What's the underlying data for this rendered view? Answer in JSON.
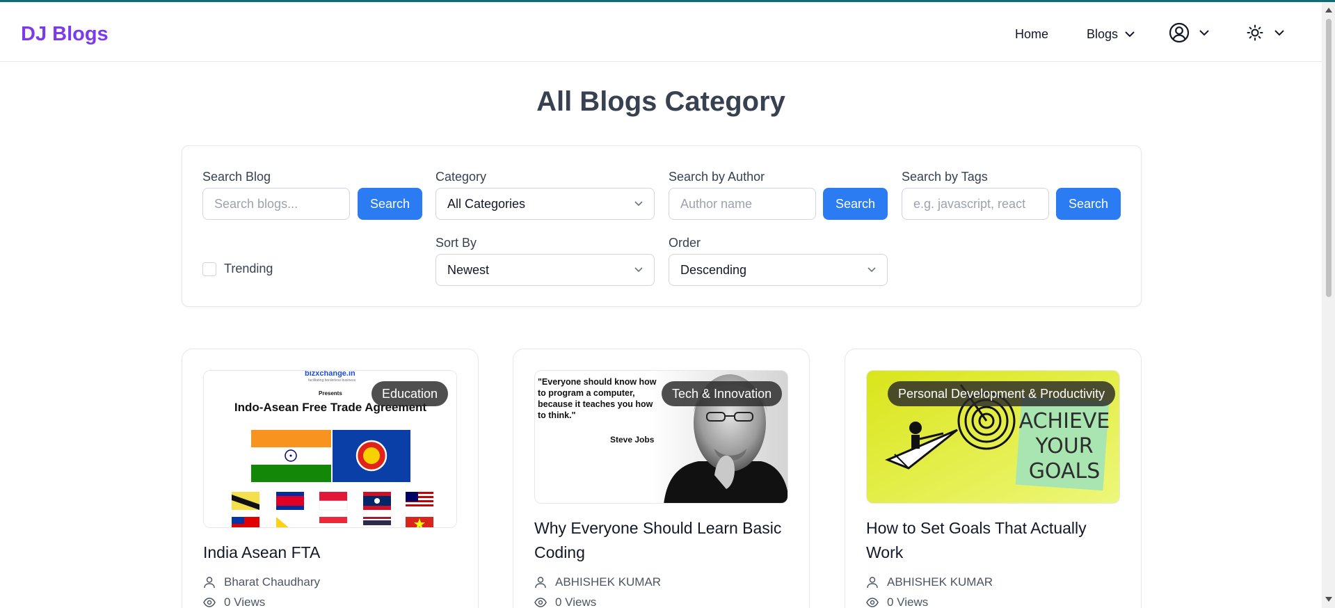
{
  "brand": {
    "logo": "DJ Blogs",
    "logo_color": "#7c3aed",
    "accent": "#2b7cf2"
  },
  "nav": {
    "home": "Home",
    "blogs": "Blogs",
    "user_icon": "user-circle-icon",
    "theme_icon": "sun-icon"
  },
  "page": {
    "title": "All Blogs Category"
  },
  "filters": {
    "search_blog": {
      "label": "Search Blog",
      "placeholder": "Search blogs...",
      "button": "Search"
    },
    "category": {
      "label": "Category",
      "value": "All Categories"
    },
    "author": {
      "label": "Search by Author",
      "placeholder": "Author name",
      "button": "Search"
    },
    "tags": {
      "label": "Search by Tags",
      "placeholder": "e.g. javascript, react",
      "button": "Search"
    },
    "trending": {
      "label": "Trending",
      "checked": false
    },
    "sort_by": {
      "label": "Sort By",
      "value": "Newest"
    },
    "order": {
      "label": "Order",
      "value": "Descending"
    }
  },
  "cards": [
    {
      "category": "Education",
      "title": "India Asean FTA",
      "author": "Bharat Chaudhary",
      "views": "0 Views",
      "image": {
        "brand": "bizxchange.in",
        "tagline": "facilitating borderless business",
        "presents": "Presents",
        "headline": "Indo-Asean Free Trade Agreement"
      }
    },
    {
      "category": "Tech & Innovation",
      "title": "Why Everyone Should Learn Basic Coding",
      "author": "ABHISHEK KUMAR",
      "views": "0 Views",
      "image": {
        "quote": "\"Everyone should know how to program a computer, because it teaches you how to think.\"",
        "attribution": "Steve Jobs"
      }
    },
    {
      "category": "Personal Development & Productivity",
      "title": "How to Set Goals That Actually Work",
      "author": "ABHISHEK KUMAR",
      "views": "0 Views",
      "image": {
        "note_lines": [
          "ACHIEVE",
          "YOUR",
          "GOALS"
        ]
      }
    }
  ]
}
